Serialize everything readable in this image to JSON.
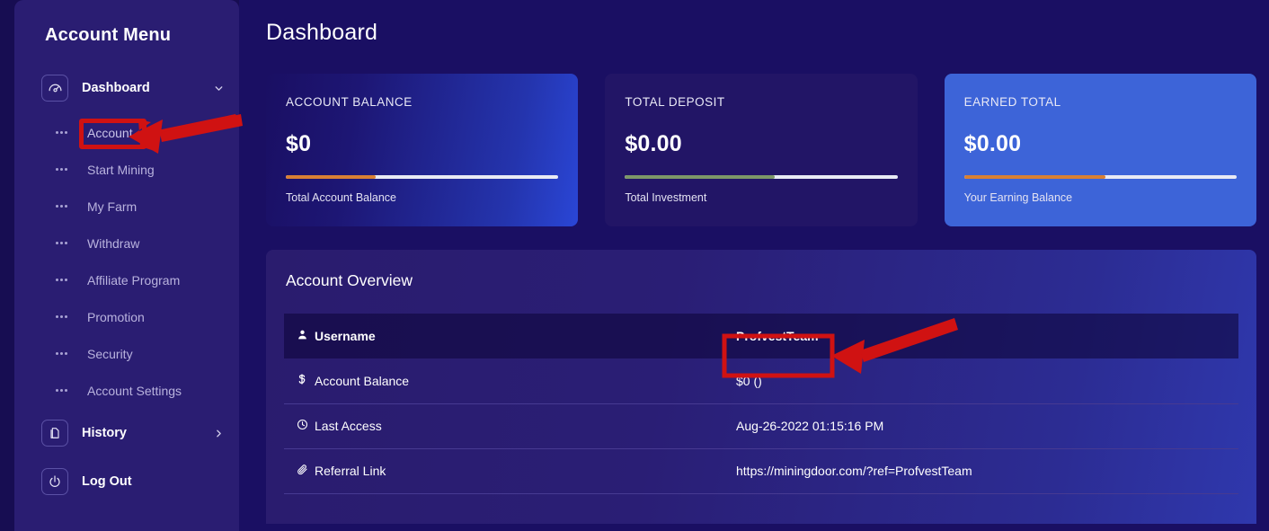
{
  "sidebar": {
    "title": "Account Menu",
    "groups": [
      {
        "label": "Dashboard",
        "icon": "gauge-icon",
        "chevron": "chevron-down-icon",
        "items": [
          {
            "label": "Account",
            "highlighted": true
          },
          {
            "label": "Start Mining",
            "highlighted": false
          },
          {
            "label": "My Farm",
            "highlighted": false
          },
          {
            "label": "Withdraw",
            "highlighted": false
          },
          {
            "label": "Affiliate Program",
            "highlighted": false
          },
          {
            "label": "Promotion",
            "highlighted": false
          },
          {
            "label": "Security",
            "highlighted": false
          },
          {
            "label": "Account Settings",
            "highlighted": false
          }
        ]
      }
    ],
    "single_items": [
      {
        "label": "History",
        "icon": "documents-icon",
        "chevron": "chevron-right-icon"
      },
      {
        "label": "Log Out",
        "icon": "power-icon",
        "chevron": ""
      }
    ]
  },
  "main": {
    "page_title": "Dashboard",
    "cards": [
      {
        "caption": "ACCOUNT BALANCE",
        "value": "$0",
        "sub": "Total Account Balance",
        "progress_pct": 33,
        "bar_color": "#d98034"
      },
      {
        "caption": "TOTAL DEPOSIT",
        "value": "$0.00",
        "sub": "Total Investment",
        "progress_pct": 55,
        "bar_color": "#7d9768"
      },
      {
        "caption": "EARNED TOTAL",
        "value": "$0.00",
        "sub": "Your Earning Balance",
        "progress_pct": 52,
        "bar_color": "#d98034"
      }
    ],
    "overview": {
      "title": "Account Overview",
      "header": {
        "icon": "user-icon",
        "label": "Username",
        "value": "ProfvestTeam"
      },
      "rows": [
        {
          "icon": "dollar-icon",
          "label": "Account Balance",
          "value": "$0 ()"
        },
        {
          "icon": "clock-icon",
          "label": "Last Access",
          "value": "Aug-26-2022 01:15:16 PM"
        },
        {
          "icon": "paperclip-icon",
          "label": "Referral Link",
          "value": "https://miningdoor.com/?ref=ProfvestTeam"
        }
      ]
    }
  },
  "annotations": {
    "highlight_color": "#d01212",
    "boxes": [
      "account-menu-item",
      "username-value"
    ],
    "arrows": [
      "arrow-to-account",
      "arrow-to-username"
    ]
  }
}
